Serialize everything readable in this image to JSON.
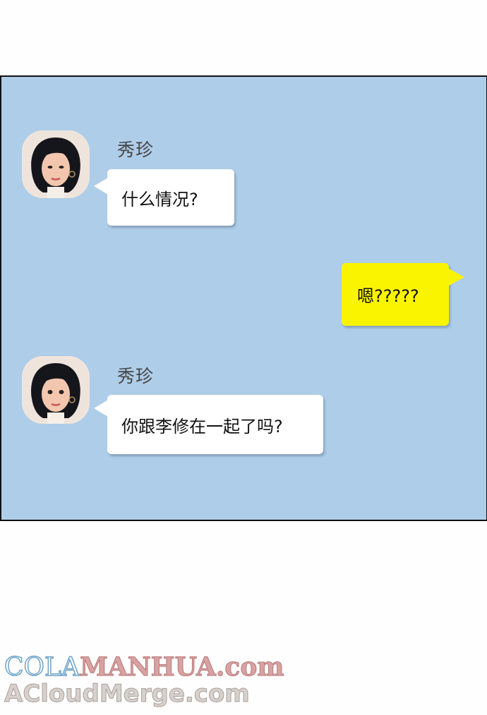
{
  "chat": {
    "messages": [
      {
        "sender": "秀珍",
        "text": "什么情况?",
        "side": "left"
      },
      {
        "sender": "",
        "text": "嗯?????",
        "side": "right"
      },
      {
        "sender": "秀珍",
        "text": "你跟李修在一起了吗?",
        "side": "left"
      }
    ],
    "colors": {
      "background": "#aecde9",
      "incoming_bubble": "#ffffff",
      "outgoing_bubble": "#fbf400"
    },
    "avatar_icon": "woman-portrait-avatar"
  },
  "watermark": {
    "line1_part_a": "COLA",
    "line1_part_b": "MANHUA.com",
    "line2": "ACloudMerge.com"
  }
}
